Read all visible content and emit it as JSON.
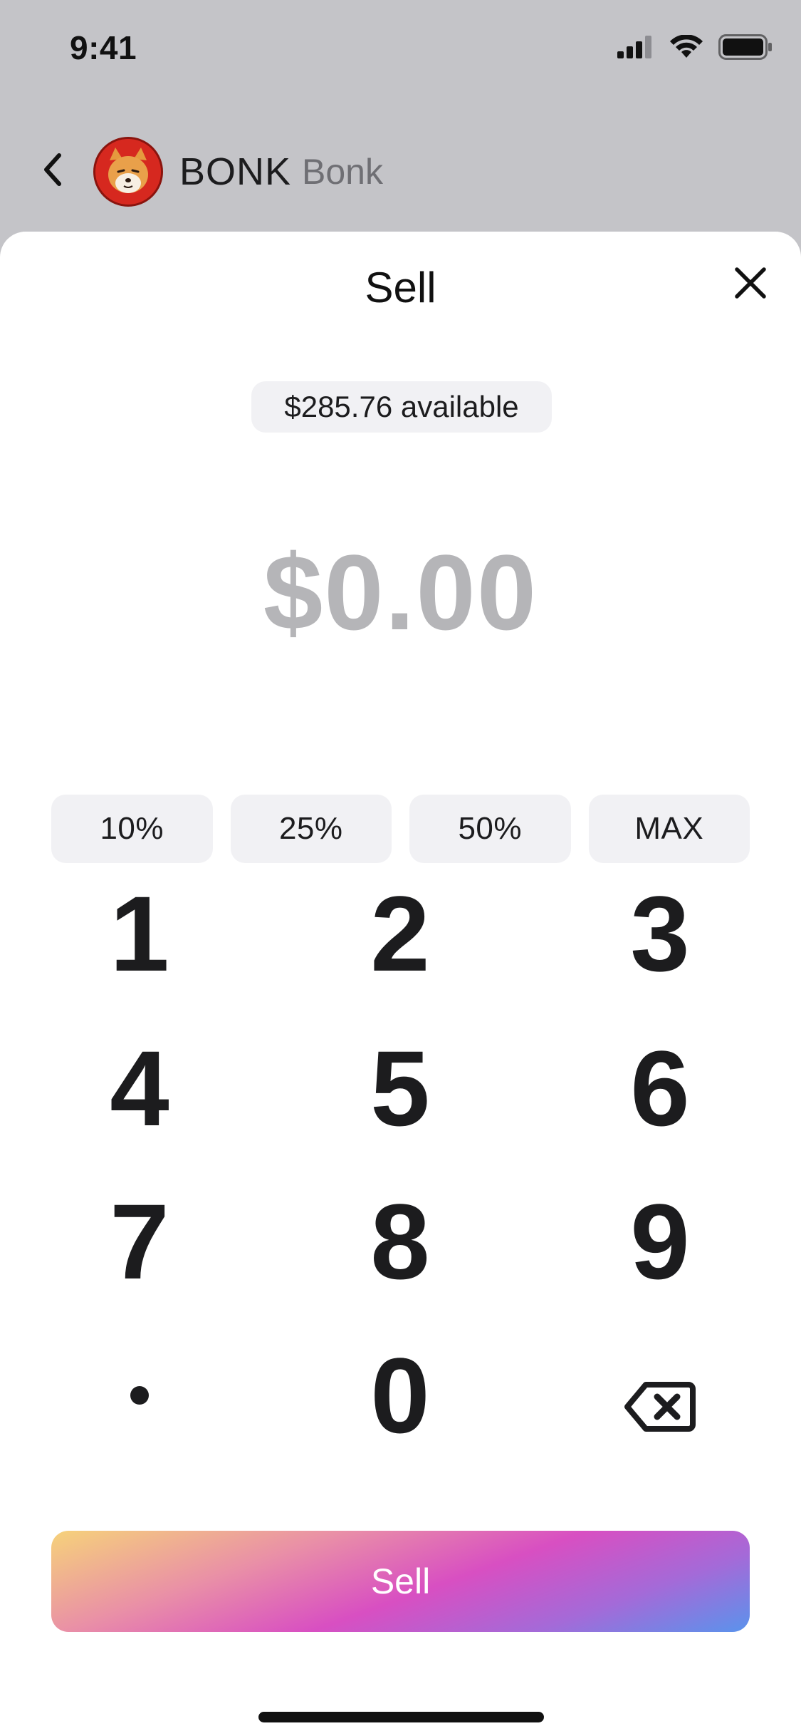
{
  "status_bar": {
    "time": "9:41"
  },
  "token": {
    "symbol": "BONK",
    "name": "Bonk"
  },
  "sheet": {
    "title": "Sell",
    "available": "$285.76 available",
    "amount": "$0.00"
  },
  "percent_buttons": [
    "10%",
    "25%",
    "50%",
    "MAX"
  ],
  "keypad": {
    "keys": [
      "1",
      "2",
      "3",
      "4",
      "5",
      "6",
      "7",
      "8",
      "9",
      ".",
      "0",
      "backspace"
    ]
  },
  "sell_button": {
    "label": "Sell"
  },
  "colors": {
    "amount_placeholder": "#b5b5b8",
    "pill_bg": "#f1f1f4",
    "gradient": [
      "#f6d27a",
      "#e98fa7",
      "#d84fc2",
      "#a46ad8",
      "#5a93ec"
    ]
  },
  "icons": {
    "back": "chevron-left-icon",
    "close": "close-icon",
    "backspace": "backspace-icon",
    "signal": "cellular-signal-icon",
    "wifi": "wifi-icon",
    "battery": "battery-icon"
  }
}
